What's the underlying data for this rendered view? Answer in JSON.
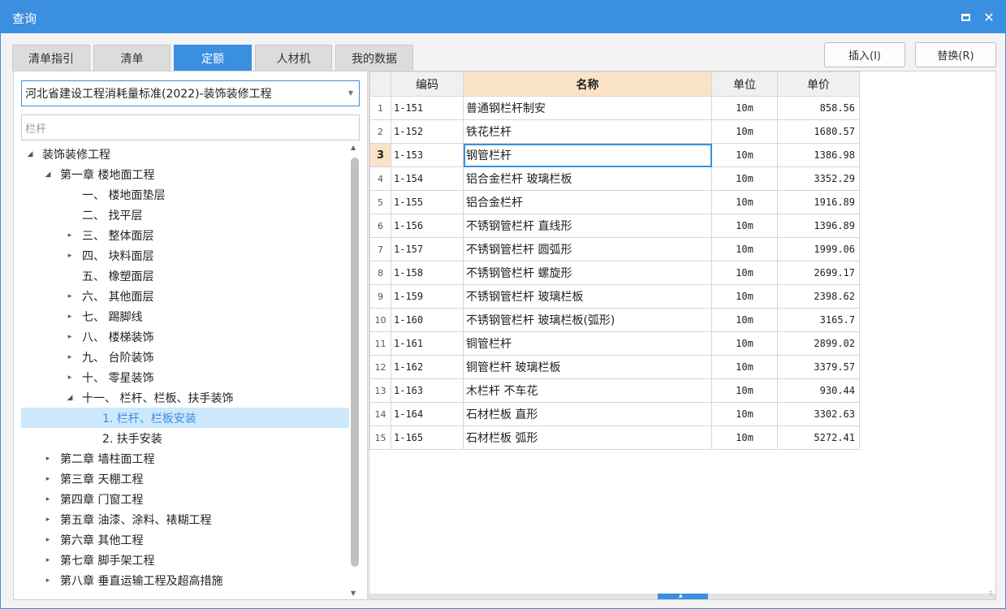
{
  "window": {
    "title": "查询",
    "maximize_icon": "square-icon",
    "close_icon": "close-icon",
    "close_glyph": "✕"
  },
  "tabs": [
    {
      "label": "清单指引",
      "active": false
    },
    {
      "label": "清单",
      "active": false
    },
    {
      "label": "定额",
      "active": true
    },
    {
      "label": "人材机",
      "active": false
    },
    {
      "label": "我的数据",
      "active": false
    }
  ],
  "buttons": {
    "insert": "插入(I)",
    "replace": "替换(R)"
  },
  "library_select": {
    "value": "河北省建设工程消耗量标准(2022)-装饰装修工程"
  },
  "search": {
    "value": "栏杆"
  },
  "tree": [
    {
      "level": 0,
      "expanded": true,
      "label": "装饰装修工程"
    },
    {
      "level": 1,
      "expanded": true,
      "label": "第一章 楼地面工程"
    },
    {
      "level": 2,
      "expanded": null,
      "label": "一、 楼地面垫层"
    },
    {
      "level": 2,
      "expanded": null,
      "label": "二、 找平层"
    },
    {
      "level": 2,
      "expanded": false,
      "label": "三、 整体面层"
    },
    {
      "level": 2,
      "expanded": false,
      "label": "四、 块料面层"
    },
    {
      "level": 2,
      "expanded": null,
      "label": "五、 橡塑面层"
    },
    {
      "level": 2,
      "expanded": false,
      "label": "六、 其他面层"
    },
    {
      "level": 2,
      "expanded": false,
      "label": "七、 踢脚线"
    },
    {
      "level": 2,
      "expanded": false,
      "label": "八、 楼梯装饰"
    },
    {
      "level": 2,
      "expanded": false,
      "label": "九、 台阶装饰"
    },
    {
      "level": 2,
      "expanded": false,
      "label": "十、 零星装饰"
    },
    {
      "level": 2,
      "expanded": true,
      "label": "十一、 栏杆、栏板、扶手装饰"
    },
    {
      "level": 3,
      "expanded": null,
      "label": "1. 栏杆、栏板安装",
      "selected": true
    },
    {
      "level": 3,
      "expanded": null,
      "label": "2. 扶手安装"
    },
    {
      "level": 1,
      "expanded": false,
      "label": "第二章 墙柱面工程"
    },
    {
      "level": 1,
      "expanded": false,
      "label": "第三章 天棚工程"
    },
    {
      "level": 1,
      "expanded": false,
      "label": "第四章 门窗工程"
    },
    {
      "level": 1,
      "expanded": false,
      "label": "第五章 油漆、涂料、裱糊工程"
    },
    {
      "level": 1,
      "expanded": false,
      "label": "第六章 其他工程"
    },
    {
      "level": 1,
      "expanded": false,
      "label": "第七章 脚手架工程"
    },
    {
      "level": 1,
      "expanded": false,
      "label": "第八章 垂直运输工程及超高措施"
    }
  ],
  "grid": {
    "headers": {
      "code": "编码",
      "name": "名称",
      "unit": "单位",
      "price": "单价"
    },
    "current_row": 3,
    "rows": [
      {
        "n": "1",
        "code": "1-151",
        "name": "普通钢栏杆制安",
        "unit": "10m",
        "price": "858.56"
      },
      {
        "n": "2",
        "code": "1-152",
        "name": "铁花栏杆",
        "unit": "10m",
        "price": "1680.57"
      },
      {
        "n": "3",
        "code": "1-153",
        "name": "钢管栏杆",
        "unit": "10m",
        "price": "1386.98"
      },
      {
        "n": "4",
        "code": "1-154",
        "name": "铝合金栏杆 玻璃栏板",
        "unit": "10m",
        "price": "3352.29"
      },
      {
        "n": "5",
        "code": "1-155",
        "name": "铝合金栏杆",
        "unit": "10m",
        "price": "1916.89"
      },
      {
        "n": "6",
        "code": "1-156",
        "name": "不锈钢管栏杆 直线形",
        "unit": "10m",
        "price": "1396.89"
      },
      {
        "n": "7",
        "code": "1-157",
        "name": "不锈钢管栏杆 圆弧形",
        "unit": "10m",
        "price": "1999.06"
      },
      {
        "n": "8",
        "code": "1-158",
        "name": "不锈钢管栏杆 螺旋形",
        "unit": "10m",
        "price": "2699.17"
      },
      {
        "n": "9",
        "code": "1-159",
        "name": "不锈钢管栏杆 玻璃栏板",
        "unit": "10m",
        "price": "2398.62"
      },
      {
        "n": "10",
        "code": "1-160",
        "name": "不锈钢管栏杆 玻璃栏板(弧形)",
        "unit": "10m",
        "price": "3165.7"
      },
      {
        "n": "11",
        "code": "1-161",
        "name": "铜管栏杆",
        "unit": "10m",
        "price": "2899.02"
      },
      {
        "n": "12",
        "code": "1-162",
        "name": "铜管栏杆 玻璃栏板",
        "unit": "10m",
        "price": "3379.57"
      },
      {
        "n": "13",
        "code": "1-163",
        "name": "木栏杆 不车花",
        "unit": "10m",
        "price": "930.44"
      },
      {
        "n": "14",
        "code": "1-164",
        "name": "石材栏板 直形",
        "unit": "10m",
        "price": "3302.63"
      },
      {
        "n": "15",
        "code": "1-165",
        "name": "石材栏板 弧形",
        "unit": "10m",
        "price": "5272.41"
      }
    ]
  },
  "colors": {
    "accent": "#3b8fe0",
    "header_highlight": "#fbe3c6",
    "selection": "#cde8fb"
  }
}
